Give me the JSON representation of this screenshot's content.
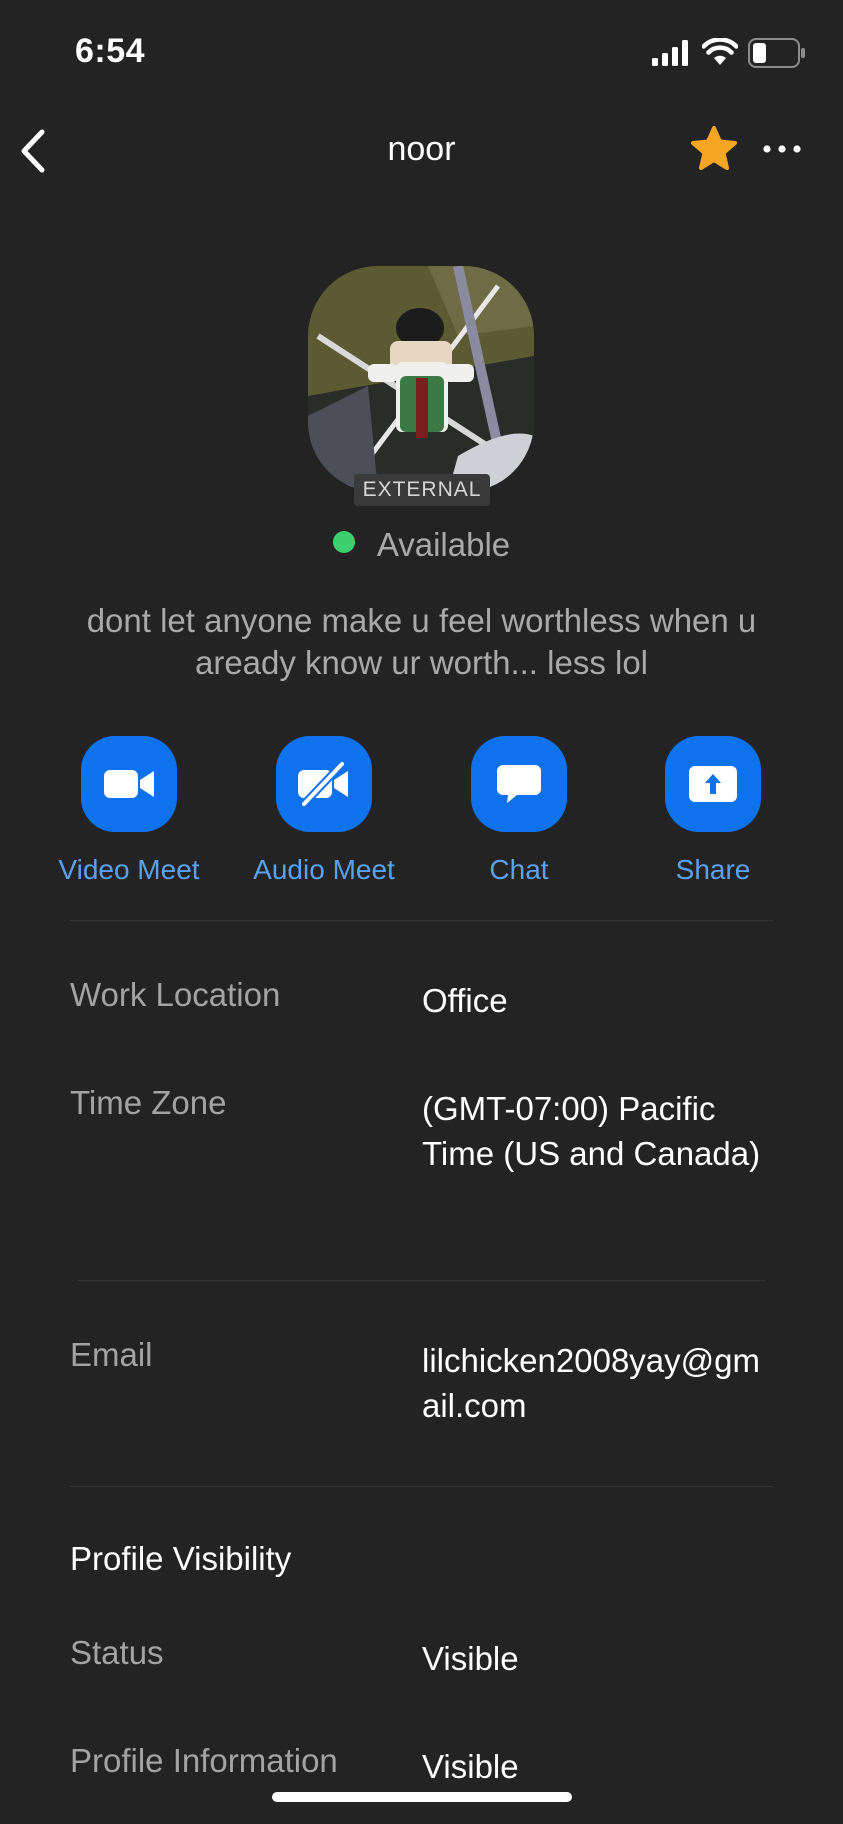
{
  "status_bar": {
    "time": "6:54"
  },
  "header": {
    "title": "noor"
  },
  "profile": {
    "badge": "EXTERNAL",
    "presence": "Available",
    "status_message": "dont let anyone make u feel worthless when u aready know ur worth... less lol"
  },
  "actions": [
    {
      "label": "Video Meet",
      "icon": "video-camera-icon"
    },
    {
      "label": "Audio Meet",
      "icon": "camera-off-icon"
    },
    {
      "label": "Chat",
      "icon": "chat-bubble-icon"
    },
    {
      "label": "Share",
      "icon": "share-upload-icon"
    }
  ],
  "info": {
    "work_location": {
      "label": "Work Location",
      "value": "Office"
    },
    "time_zone": {
      "label": "Time Zone",
      "value": "(GMT-07:00) Pacific Time (US and Canada)"
    },
    "email": {
      "label": "Email",
      "value": "lilchicken2008yay@gmail.com"
    }
  },
  "visibility": {
    "title": "Profile Visibility",
    "status": {
      "label": "Status",
      "value": "Visible"
    },
    "profile_information": {
      "label": "Profile Information",
      "value": "Visible"
    }
  },
  "colors": {
    "background": "#232323",
    "accent": "#0e72ed",
    "accent_text": "#5aa1f2",
    "favorite_star": "#f6a623",
    "presence_green": "#3ecf6e"
  }
}
